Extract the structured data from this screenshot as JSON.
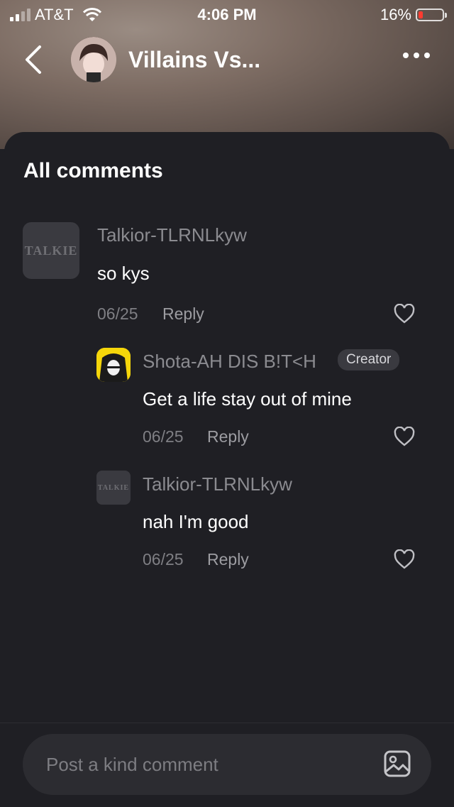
{
  "status_bar": {
    "carrier": "AT&T",
    "time": "4:06 PM",
    "battery": "16%"
  },
  "nav": {
    "title": "Villains Vs..."
  },
  "comments_heading": "All comments",
  "comments": [
    {
      "username": "Talkior-TLRNLkyw",
      "avatar_text": "TALKIE",
      "text": "so kys",
      "date": "06/25",
      "reply": "Reply"
    },
    {
      "username": "Shota-AH DIS B!T<H",
      "badge": "Creator",
      "text": "Get a life stay out of mine",
      "date": "06/25",
      "reply": "Reply"
    },
    {
      "username": "Talkior-TLRNLkyw",
      "avatar_text": "TALKIE",
      "text": "nah I'm good",
      "date": "06/25",
      "reply": "Reply"
    }
  ],
  "composer": {
    "placeholder": "Post a kind comment"
  },
  "colors": {
    "background": "#1f1f24",
    "surface": "#2c2c31",
    "battery_low": "#ff3b30"
  }
}
